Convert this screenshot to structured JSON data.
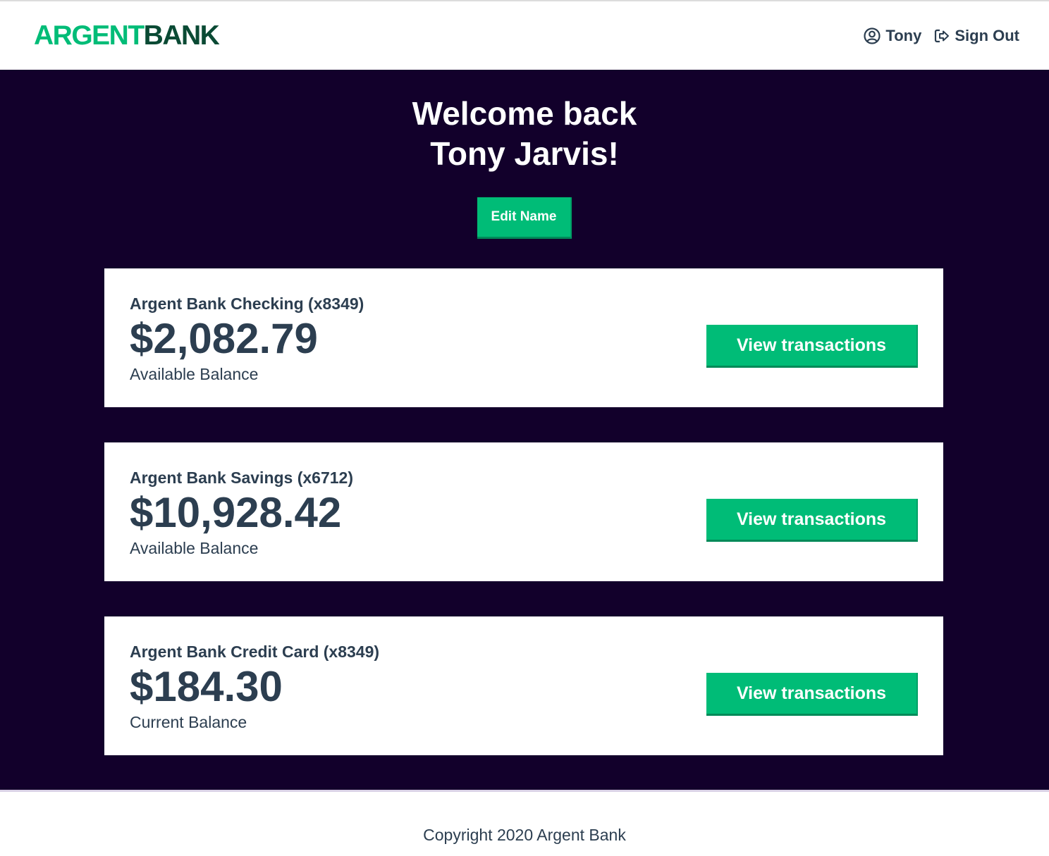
{
  "brand": {
    "part1": "ARGENT",
    "part2": "BANK",
    "colors": {
      "accent": "#00bc77",
      "dark_green": "#0a4a34",
      "main_bg": "#12002b"
    }
  },
  "nav": {
    "user": {
      "label": "Tony",
      "icon": "user-circle-icon"
    },
    "signout": {
      "label": "Sign Out",
      "icon": "sign-out-icon"
    }
  },
  "header": {
    "line1": "Welcome back",
    "line2": "Tony Jarvis!",
    "edit_label": "Edit Name"
  },
  "accounts": [
    {
      "title": "Argent Bank Checking (x8349)",
      "amount": "$2,082.79",
      "description": "Available Balance",
      "button": "View transactions"
    },
    {
      "title": "Argent Bank Savings (x6712)",
      "amount": "$10,928.42",
      "description": "Available Balance",
      "button": "View transactions"
    },
    {
      "title": "Argent Bank Credit Card (x8349)",
      "amount": "$184.30",
      "description": "Current Balance",
      "button": "View transactions"
    }
  ],
  "footer": {
    "copyright": "Copyright 2020 Argent Bank"
  }
}
